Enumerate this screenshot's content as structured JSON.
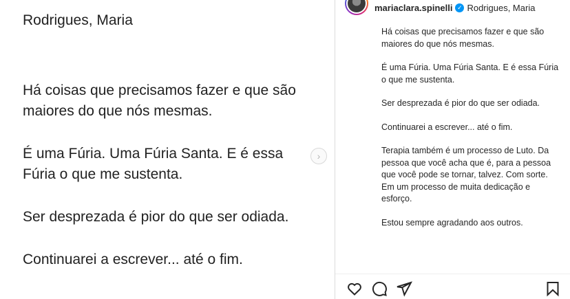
{
  "post_image": {
    "author": "Rodrigues, Maria",
    "paragraphs": [
      "Há coisas que precisamos fazer e que são maiores do que nós mesmas.",
      "É uma Fúria. Uma Fúria Santa. E é essa Fúria o que me sustenta.",
      "Ser desprezada é pior do que ser odiada.",
      "Continuarei a escrever... até o fim."
    ],
    "next_icon": "chevron-right-icon"
  },
  "header": {
    "username": "mariaclara.spinelli",
    "verified_icon": "verified-badge-icon",
    "author": "Rodrigues, Maria"
  },
  "caption": {
    "paragraphs": [
      "Há coisas que precisamos fazer e que são maiores do que nós mesmas.",
      "É uma Fúria. Uma Fúria Santa. E é essa Fúria o que me sustenta.",
      "Ser desprezada é pior do que ser odiada.",
      "Continuarei a escrever... até o fim.",
      "Terapia também é um processo de Luto. Da pessoa que você acha que é, para a pessoa que você pode se tornar, talvez. Com sorte. Em um processo de muita dedicação e esforço.",
      "Estou sempre agradando aos outros."
    ]
  },
  "actions": {
    "like_icon": "heart-icon",
    "comment_icon": "comment-icon",
    "share_icon": "send-icon",
    "save_icon": "bookmark-icon"
  },
  "colors": {
    "accent": "#0095f6",
    "text": "#262626",
    "divider": "#dbdbdb"
  }
}
